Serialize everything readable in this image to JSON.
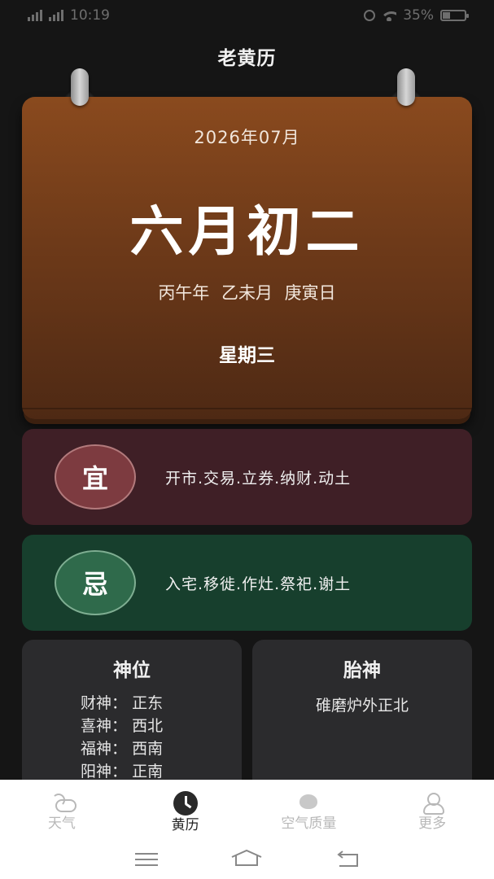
{
  "status_bar": {
    "time": "10:19",
    "battery": "35%",
    "battery_level": 0.35
  },
  "header": {
    "title": "老黄历"
  },
  "calendar": {
    "month": "2026年07月",
    "lunar_date": "六月初二",
    "ganzhi": "丙午年 乙未月 庚寅日",
    "weekday": "星期三"
  },
  "yi": {
    "seal": "宜",
    "items": "开市.交易.立券.纳财.动土",
    "color": "#3f1f26"
  },
  "ji": {
    "seal": "忌",
    "items": "入宅.移徙.作灶.祭祀.谢土",
    "color": "#173f2d"
  },
  "shenwei": {
    "title": "神位",
    "rows": [
      {
        "label": "财神：",
        "value": "正东"
      },
      {
        "label": "喜神：",
        "value": "西北"
      },
      {
        "label": "福神：",
        "value": "西南"
      },
      {
        "label": "阳神：",
        "value": "正南"
      }
    ]
  },
  "taishen": {
    "title": "胎神",
    "value": "碓磨炉外正北"
  },
  "tabs": [
    {
      "label": "天气",
      "icon": "weather-icon",
      "active": false
    },
    {
      "label": "黄历",
      "icon": "clock-icon",
      "active": true
    },
    {
      "label": "空气质量",
      "icon": "air-quality-icon",
      "active": false
    },
    {
      "label": "更多",
      "icon": "user-icon",
      "active": false
    }
  ],
  "system_nav": [
    "menu-icon",
    "home-icon",
    "back-icon"
  ]
}
